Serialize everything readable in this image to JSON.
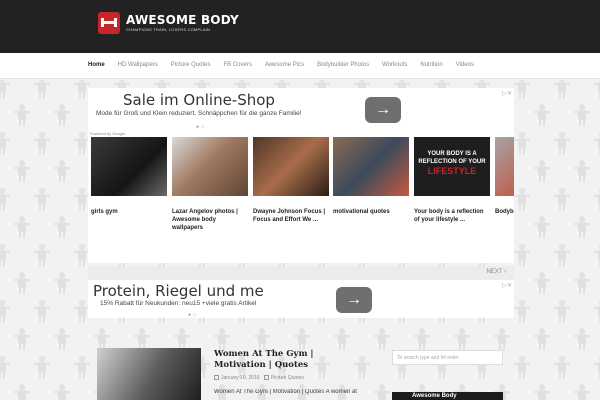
{
  "header": {
    "logo_title": "AWESOME BODY",
    "logo_tagline": "CHAMPIONS TRAIN, LOSERS COMPLAIN"
  },
  "nav": {
    "items": [
      "Home",
      "HD Wallpapers",
      "Picture Quotes",
      "FB Covers",
      "Awesome Pics",
      "Bodybuilder Photos",
      "Workouts",
      "Nutrition",
      "Videos"
    ]
  },
  "ad1": {
    "title": "Sale im Online-Shop",
    "subtitle": "Mode für Groß und Klein reduziert. Schnäppchen für die ganze Familie!",
    "arrow": "→"
  },
  "carousel": {
    "powered_by": "Powered by Google",
    "cards": [
      {
        "caption": "girls gym"
      },
      {
        "caption": "Lazar Angelov photos | Awesome body wallpapers"
      },
      {
        "caption": "Dwayne Johnson Focus | Focus and Effort We ..."
      },
      {
        "caption": "motivational quotes"
      },
      {
        "caption": "Your body is a reflection of your lifestyle ...",
        "image_text_1": "YOUR BODY IS A REFLECTION OF YOUR",
        "image_text_2": "LIFESTYLE"
      },
      {
        "caption": "Bodyb... quote... Quote..."
      }
    ],
    "next_label": "NEXT ›"
  },
  "ad2": {
    "title": "Protein, Riegel und me",
    "subtitle": "15% Rabatt für Neukunden: neu15 +viele gratis Artikel",
    "arrow": "→"
  },
  "post": {
    "title": "Women At The Gym | Motivation | Quotes",
    "date": "January 10, 2016",
    "category": "Picture Quotes",
    "excerpt": "Women At The Gym | Motivation | Quotes A women at"
  },
  "sidebar": {
    "search_placeholder": "To search type and hit enter",
    "widget_title": "Awesome Body"
  },
  "colors": {
    "header_bg": "#222222",
    "accent": "#c8262a",
    "ad_button": "#6f6f6f"
  }
}
